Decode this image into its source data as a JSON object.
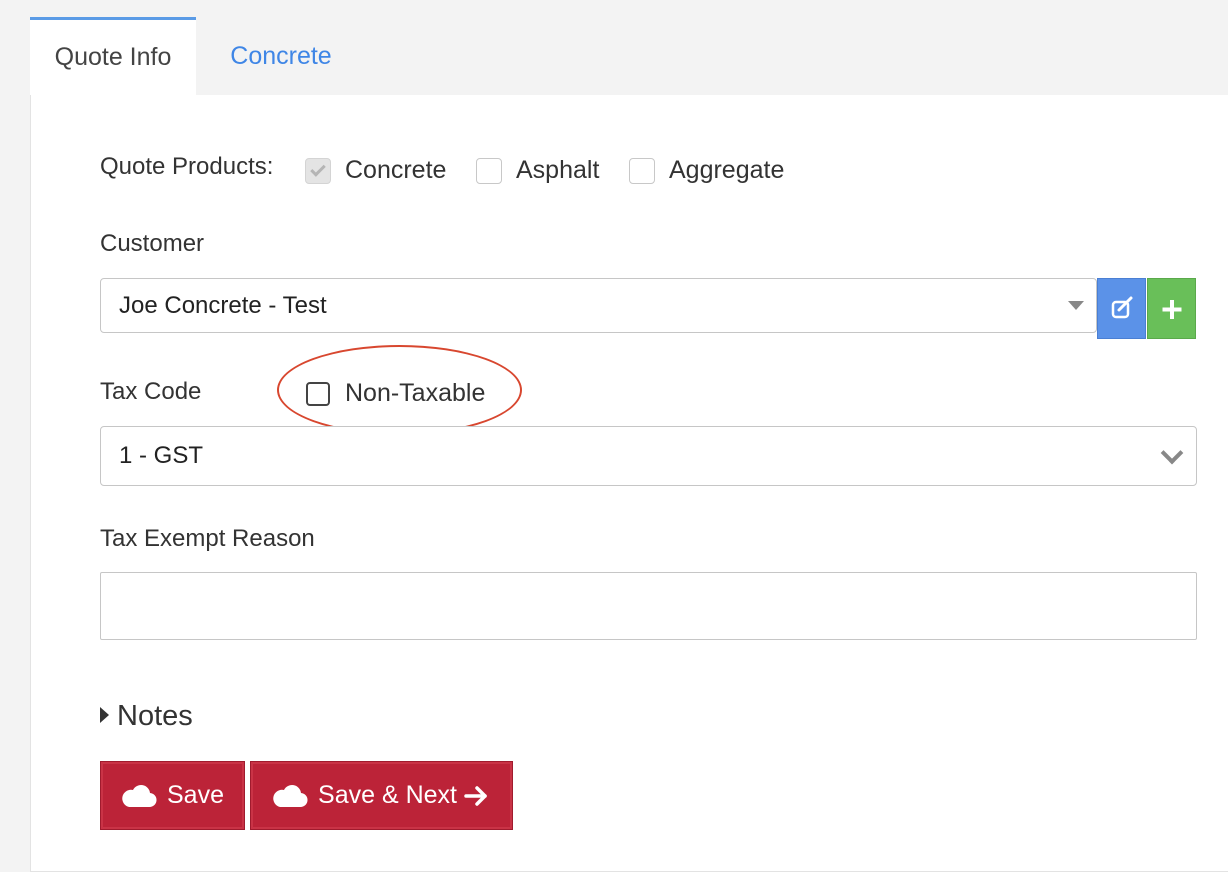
{
  "tabs": [
    {
      "label": "Quote Info",
      "active": true
    },
    {
      "label": "Concrete",
      "active": false
    }
  ],
  "quote_products": {
    "label": "Quote Products:",
    "options": [
      {
        "label": "Concrete",
        "checked": true,
        "disabled": true
      },
      {
        "label": "Asphalt",
        "checked": false
      },
      {
        "label": "Aggregate",
        "checked": false
      }
    ]
  },
  "customer": {
    "label": "Customer",
    "value": "Joe Concrete - Test"
  },
  "tax_code": {
    "label": "Tax Code",
    "non_taxable_label": "Non-Taxable",
    "non_taxable_checked": false,
    "value": "1 - GST"
  },
  "tax_exempt": {
    "label": "Tax Exempt Reason",
    "value": ""
  },
  "notes": {
    "label": "Notes"
  },
  "actions": {
    "save_label": "Save",
    "save_next_label": "Save & Next"
  },
  "colors": {
    "primary_red": "#bc2338",
    "edit_blue": "#5b92e8",
    "add_green": "#69bf59",
    "tab_link": "#3f86e6",
    "highlight_ellipse": "#d8472f"
  }
}
